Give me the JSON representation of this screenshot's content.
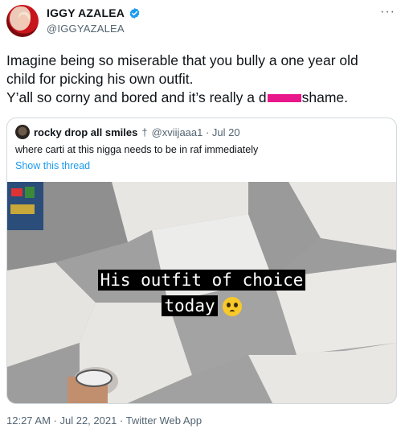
{
  "author": {
    "name": "IGGY AZALEA",
    "handle": "@IGGYAZALEA"
  },
  "more_label": "···",
  "tweet": {
    "line1": "Imagine being so miserable that you bully a one year old",
    "line2": "child for picking his own outfit.",
    "line3_start": "Y’all so corny and bored and it’s really a d",
    "line3_end": "shame."
  },
  "quote": {
    "name": "rocky drop all smiles",
    "name_symbol": "†",
    "handle_date": "@xviijaaa1 · Jul 20",
    "text": "where carti at this nigga needs to be in raf immediately",
    "show_thread": "Show this thread",
    "media": {
      "caption_line1": "His outfit of choice",
      "caption_line2": "today"
    }
  },
  "timestamp": "12:27 AM · Jul 22, 2021 · Twitter Web App",
  "colors": {
    "link": "#1d9bf0",
    "muted": "#536471",
    "censor": "#e8178a"
  }
}
